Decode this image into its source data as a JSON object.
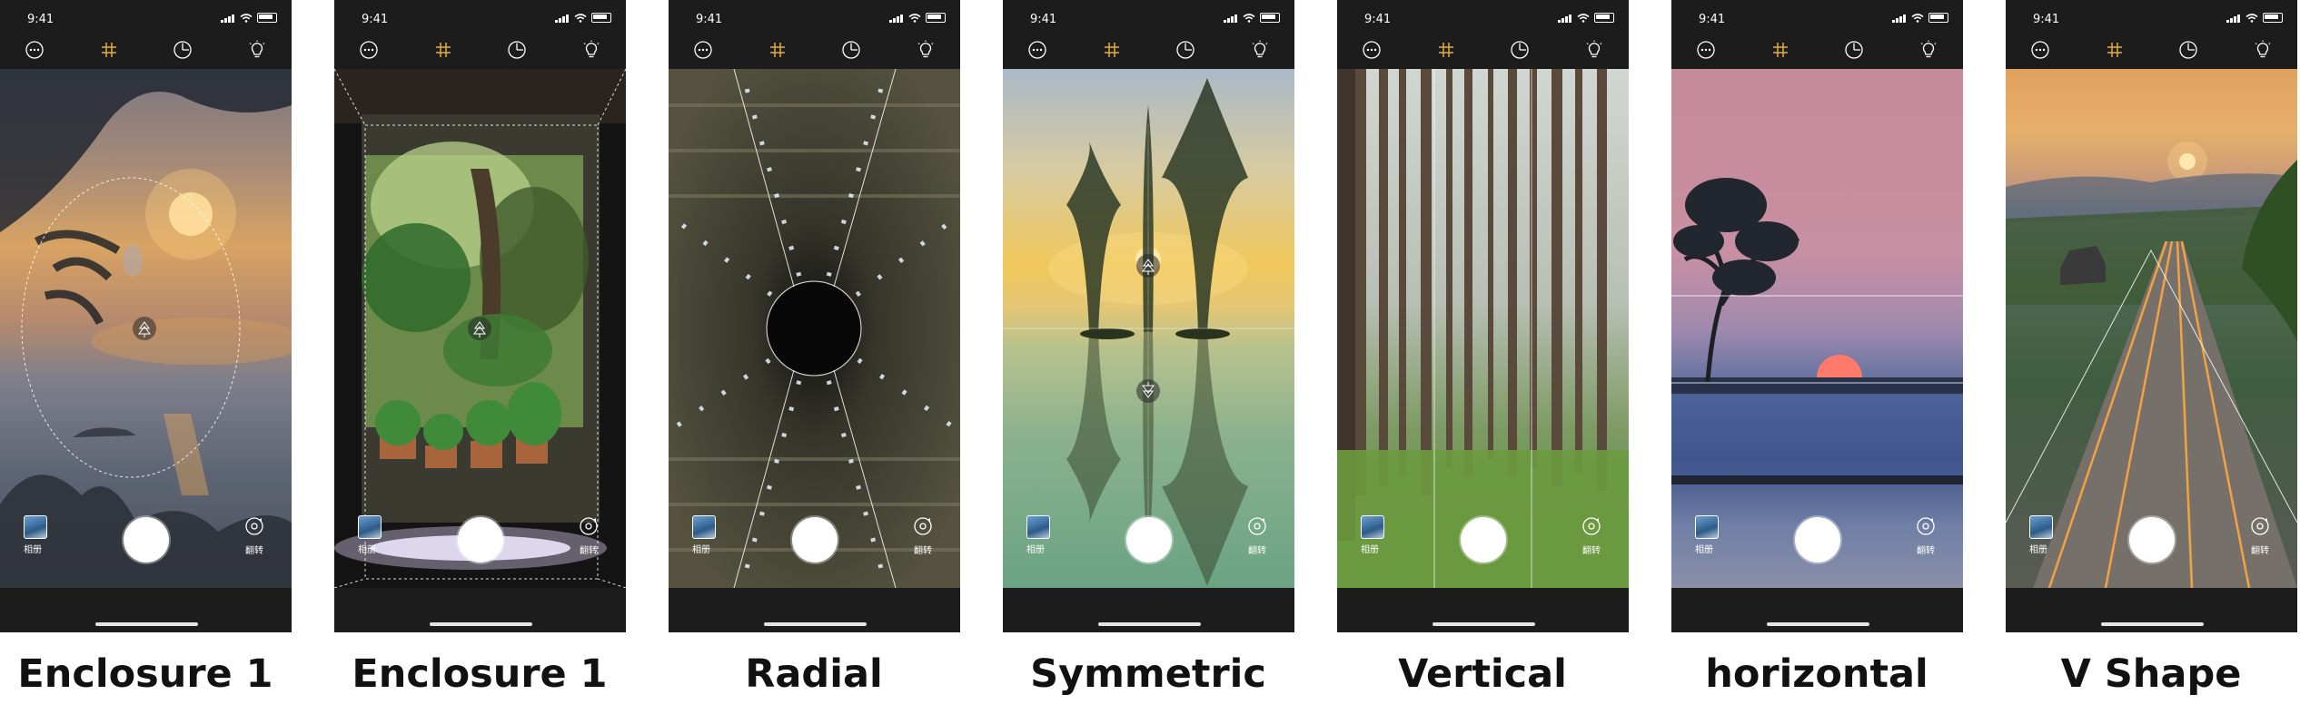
{
  "status_time": "9:41",
  "controls": {
    "album_label": "相册",
    "flip_label": "翻转"
  },
  "screens": [
    {
      "caption": "Enclosure 1",
      "composition": "oval-enclosure"
    },
    {
      "caption": "Enclosure 1",
      "composition": "frame-enclosure"
    },
    {
      "caption": "Radial",
      "composition": "radial"
    },
    {
      "caption": "Symmetric",
      "composition": "symmetric"
    },
    {
      "caption": "Vertical",
      "composition": "vertical"
    },
    {
      "caption": "horizontal",
      "composition": "horizontal"
    },
    {
      "caption": "V Shape",
      "composition": "v-shape"
    }
  ],
  "toolbar_icons": [
    "more-icon",
    "grid-icon",
    "timer-icon",
    "flash-icon"
  ],
  "colors": {
    "accent_grid": "#d9a441",
    "phone_bg": "#1c1c1c",
    "caption": "#111111"
  }
}
